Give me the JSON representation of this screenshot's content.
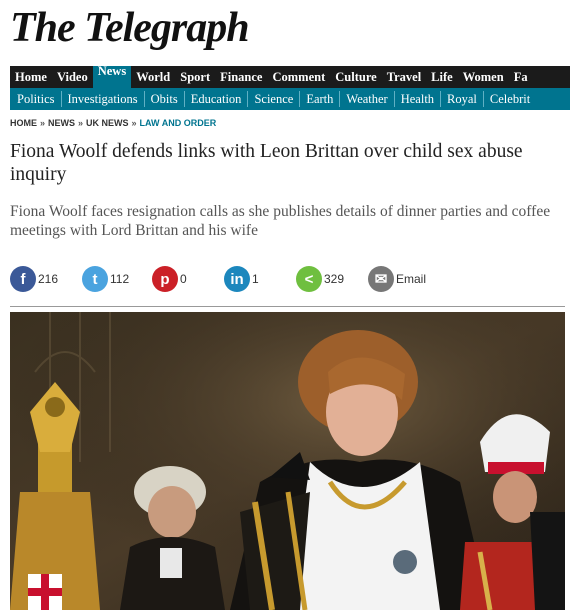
{
  "masthead": {
    "title": "The Telegraph"
  },
  "nav_primary": [
    {
      "label": "Home",
      "active": false
    },
    {
      "label": "Video",
      "active": false
    },
    {
      "label": "News",
      "active": true
    },
    {
      "label": "World",
      "active": false
    },
    {
      "label": "Sport",
      "active": false
    },
    {
      "label": "Finance",
      "active": false
    },
    {
      "label": "Comment",
      "active": false
    },
    {
      "label": "Culture",
      "active": false
    },
    {
      "label": "Travel",
      "active": false
    },
    {
      "label": "Life",
      "active": false
    },
    {
      "label": "Women",
      "active": false
    },
    {
      "label": "Fa",
      "active": false
    }
  ],
  "nav_secondary": [
    "Politics",
    "Investigations",
    "Obits",
    "Education",
    "Science",
    "Earth",
    "Weather",
    "Health",
    "Royal",
    "Celebrit"
  ],
  "breadcrumb": [
    "HOME",
    "NEWS",
    "UK NEWS",
    "LAW AND ORDER"
  ],
  "breadcrumb_separator": "»",
  "article": {
    "headline": "Fiona Woolf defends links with Leon Brittan over child sex abuse inquiry",
    "standfirst": "Fiona Woolf faces resignation calls as she publishes details of dinner parties and coffee meetings with Lord Brittan and his wife"
  },
  "share": [
    {
      "network": "facebook",
      "icon": "facebook-icon",
      "glyph": "f",
      "count": "216",
      "color": "#3b5998"
    },
    {
      "network": "twitter",
      "icon": "twitter-icon",
      "glyph": "t",
      "count": "112",
      "color": "#4aa3df"
    },
    {
      "network": "pinterest",
      "icon": "pinterest-icon",
      "glyph": "p",
      "count": "0",
      "color": "#cb2027"
    },
    {
      "network": "linkedin",
      "icon": "linkedin-icon",
      "glyph": "in",
      "count": "1",
      "color": "#1c87bd"
    },
    {
      "network": "share",
      "icon": "share-icon",
      "glyph": "<",
      "count": "329",
      "color": "#6fbf3f"
    },
    {
      "network": "email",
      "icon": "email-icon",
      "glyph": "✉",
      "count": "Email",
      "color": "#777777"
    }
  ],
  "colors": {
    "nav_dark": "#1b1b1b",
    "accent_teal": "#00748f"
  }
}
